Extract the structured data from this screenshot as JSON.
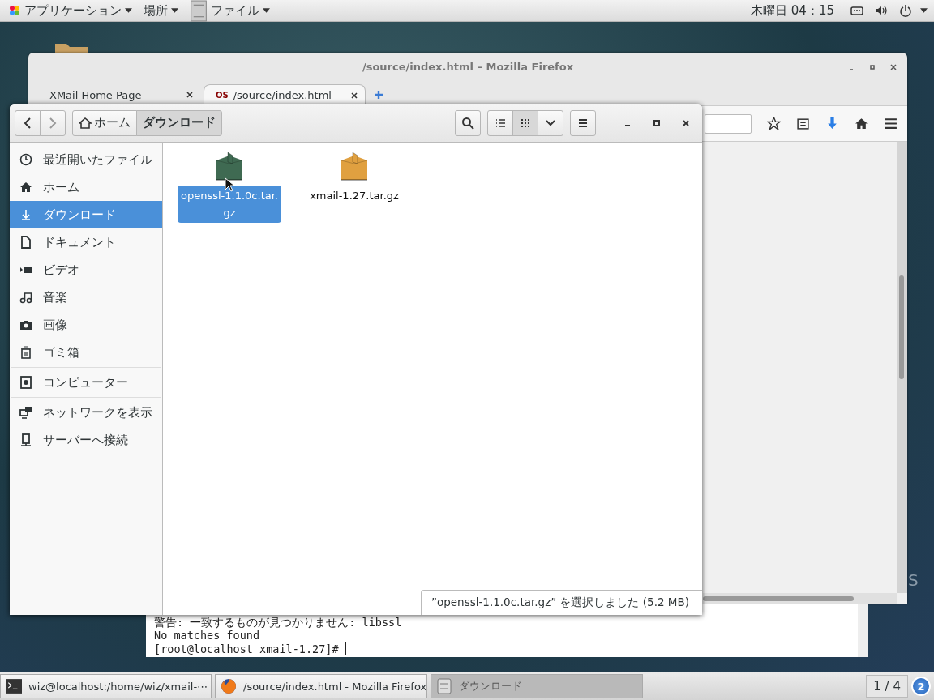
{
  "top_bar": {
    "menus": [
      {
        "label": "アプリケーション",
        "kind": "apps"
      },
      {
        "label": "場所",
        "kind": "places"
      },
      {
        "label": "ファイル",
        "kind": "files"
      }
    ],
    "clock": "木曜日 04：15"
  },
  "desktop": {
    "logo_text": "S"
  },
  "firefox": {
    "title": "/source/index.html – Mozilla Firefox",
    "tabs": [
      {
        "label": "XMail Home Page",
        "selected": false
      },
      {
        "label": "/source/index.html",
        "selected": true,
        "favicon": "OS"
      }
    ]
  },
  "terminal": {
    "lines": [
      "警告: 一致するものが見つかりません: libssl",
      "No matches found"
    ],
    "prompt": "[root@localhost xmail-1.27]#"
  },
  "files_window": {
    "path": [
      {
        "label": "ホーム",
        "kind": "home",
        "selected": false
      },
      {
        "label": "ダウンロード",
        "kind": "folder",
        "selected": true
      }
    ],
    "views": [
      {
        "kind": "list",
        "selected": false
      },
      {
        "kind": "grid",
        "selected": true
      }
    ],
    "sidebar": {
      "sections": [
        [
          {
            "label": "最近開いたファイル",
            "selected": false
          },
          {
            "label": "ホーム",
            "selected": false
          },
          {
            "label": "ダウンロード",
            "selected": true
          },
          {
            "label": "ドキュメント",
            "selected": false
          },
          {
            "label": "ビデオ",
            "selected": false
          },
          {
            "label": "音楽",
            "selected": false
          },
          {
            "label": "画像",
            "selected": false
          },
          {
            "label": "ゴミ箱",
            "selected": false
          }
        ],
        [
          {
            "label": "コンピューター",
            "selected": false
          }
        ],
        [
          {
            "label": "ネットワークを表示",
            "selected": false
          },
          {
            "label": "サーバーへ接続",
            "selected": false
          }
        ]
      ]
    },
    "files": [
      {
        "name": "openssl-1.1.0c.tar.gz",
        "selected": true,
        "color": "#3f6a52"
      },
      {
        "name": "xmail-1.27.tar.gz",
        "selected": false,
        "color": "#e0a040"
      }
    ],
    "status": "”openssl-1.1.0c.tar.gz” を選択しました (5.2 MB)"
  },
  "taskbar": {
    "tasks": [
      {
        "label": "wiz@localhost:/home/wiz/xmail-⋯",
        "selected": false
      },
      {
        "label": "/source/index.html - Mozilla Firefox",
        "selected": false
      },
      {
        "label": "ダウンロード",
        "selected": true
      }
    ],
    "workspace": "1 / 4",
    "notifications": "2"
  }
}
